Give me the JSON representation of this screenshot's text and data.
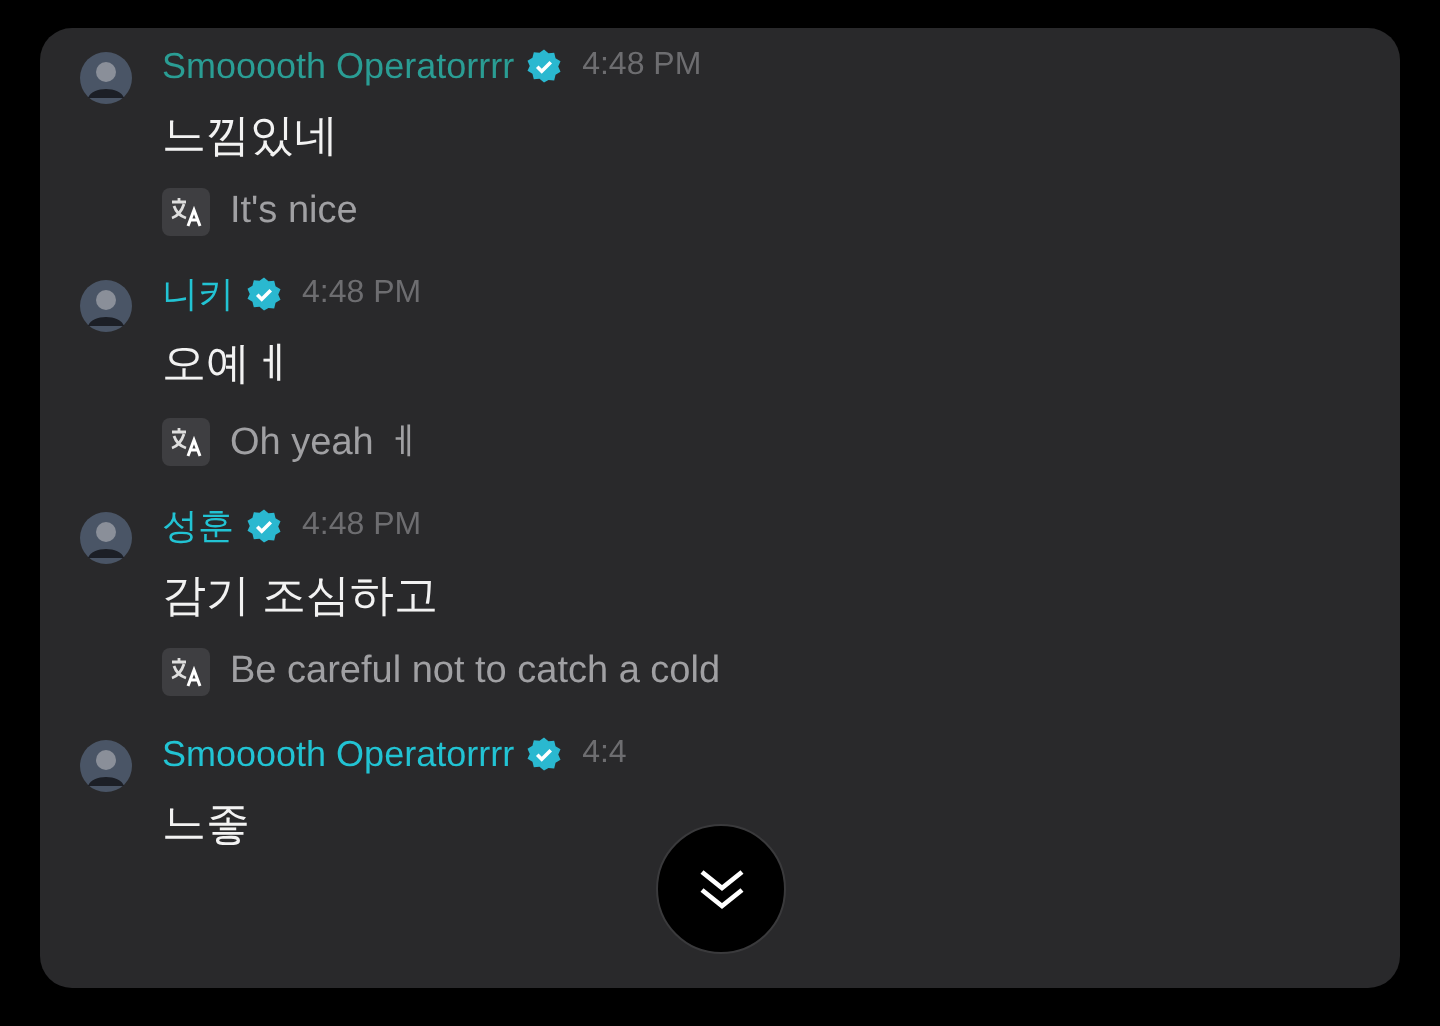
{
  "messages": [
    {
      "author": "Smooooth Operatorrrr",
      "color": "#2a9d94",
      "verified": true,
      "time": "4:48 PM",
      "text": "느낌있네",
      "translation": "It's nice"
    },
    {
      "author": "니키",
      "color": "#22c3d3",
      "verified": true,
      "time": "4:48 PM",
      "text": "오예ㅔ",
      "translation": "Oh yeah ㅔ"
    },
    {
      "author": "성훈",
      "color": "#22c3d3",
      "verified": true,
      "time": "4:48 PM",
      "text": "감기 조심하고",
      "translation": "Be careful not to catch a cold"
    },
    {
      "author": "Smooooth Operatorrrr",
      "color": "#22c3d3",
      "verified": true,
      "time": "4:4",
      "text": "느좋"
    }
  ]
}
